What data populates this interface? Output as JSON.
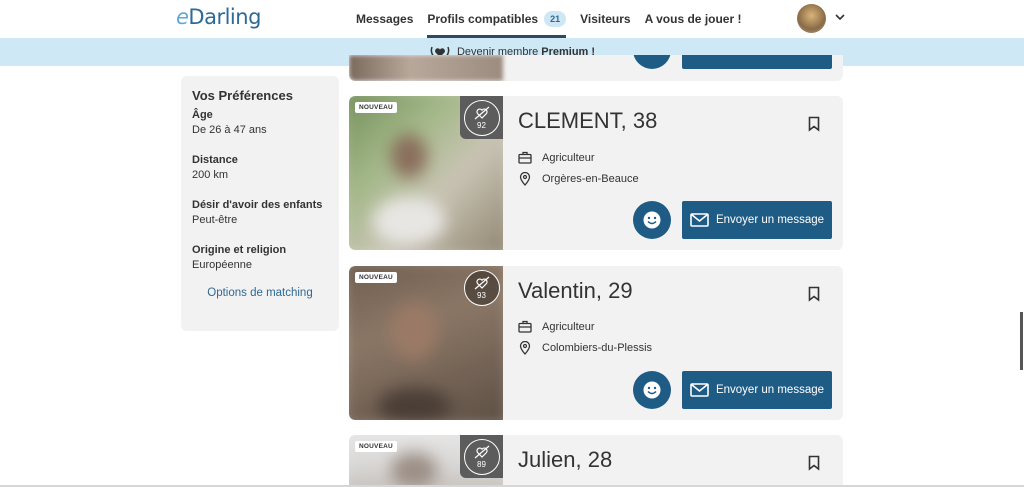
{
  "header": {
    "logo_e": "e",
    "logo_rest": "Darling",
    "nav": [
      {
        "label": "Messages"
      },
      {
        "label": "Profils compatibles",
        "badge": "21"
      },
      {
        "label": "Visiteurs"
      },
      {
        "label": "A vous de jouer !"
      }
    ]
  },
  "premium": {
    "prefix": "Devenir membre",
    "bold": "Premium !"
  },
  "preferences": {
    "title": "Vos Préférences",
    "items": [
      {
        "label": "Âge",
        "value": "De 26 à 47 ans"
      },
      {
        "label": "Distance",
        "value": "200 km"
      },
      {
        "label": "Désir d'avoir des enfants",
        "value": "Peut-être"
      },
      {
        "label": "Origine et religion",
        "value": "Européenne"
      }
    ],
    "link": "Options de matching"
  },
  "profiles": [
    {
      "tag": "NOUVEAU",
      "score": "92",
      "name": "CLEMENT, 38",
      "job": "Agriculteur",
      "location": "Orgères-en-Beauce",
      "message_label": "Envoyer un message"
    },
    {
      "tag": "NOUVEAU",
      "score": "93",
      "name": "Valentin, 29",
      "job": "Agriculteur",
      "location": "Colombiers-du-Plessis",
      "message_label": "Envoyer un message"
    },
    {
      "tag": "NOUVEAU",
      "score": "89",
      "name": "Julien, 28"
    }
  ],
  "colors": {
    "primary": "#1f5c85",
    "banner": "#cfe8f5",
    "card": "#f2f2f2"
  }
}
